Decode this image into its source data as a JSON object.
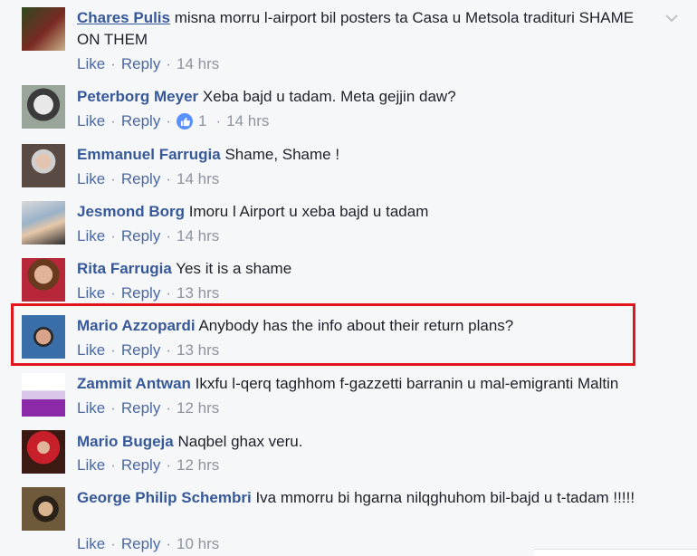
{
  "actions": {
    "like": "Like",
    "reply": "Reply",
    "separator": "·"
  },
  "comments": [
    {
      "name": "Chares Pulis",
      "text": "misna morru l-airport bil posters ta Casa u Metsola tradituri SHAME ON THEM",
      "time": "14 hrs"
    },
    {
      "name": "Peterborg Meyer",
      "text": "Xeba bajd u tadam. Meta gejjin daw?",
      "time": "14 hrs",
      "likes": "1"
    },
    {
      "name": "Emmanuel Farrugia",
      "text": "Shame, Shame !",
      "time": "14 hrs"
    },
    {
      "name": "Jesmond Borg",
      "text": "Imoru l Airport u xeba bajd u tadam",
      "time": "14 hrs"
    },
    {
      "name": "Rita Farrugia",
      "text": "Yes it is a shame",
      "time": "13 hrs"
    },
    {
      "name": "Mario Azzopardi",
      "text": "Anybody has the info about their return plans?",
      "time": "13 hrs"
    },
    {
      "name": "Zammit Antwan",
      "text": "Ikxfu l-qerq taghhom f-gazzetti barranin u mal-emigranti Maltin",
      "time": "12 hrs"
    },
    {
      "name": "Mario Bugeja",
      "text": "Naqbel ghax veru.",
      "time": "12 hrs"
    },
    {
      "name": "George Philip Schembri",
      "text": "Iva mmorru bi hgarna nilqghuhom bil-bajd u t-tadam !!!!!",
      "time": "10 hrs"
    }
  ],
  "colors": {
    "name": "#365899",
    "link": "#4b67a1",
    "muted": "#8d949e",
    "highlight": "#e0161b",
    "like_badge": "#5890ff"
  }
}
